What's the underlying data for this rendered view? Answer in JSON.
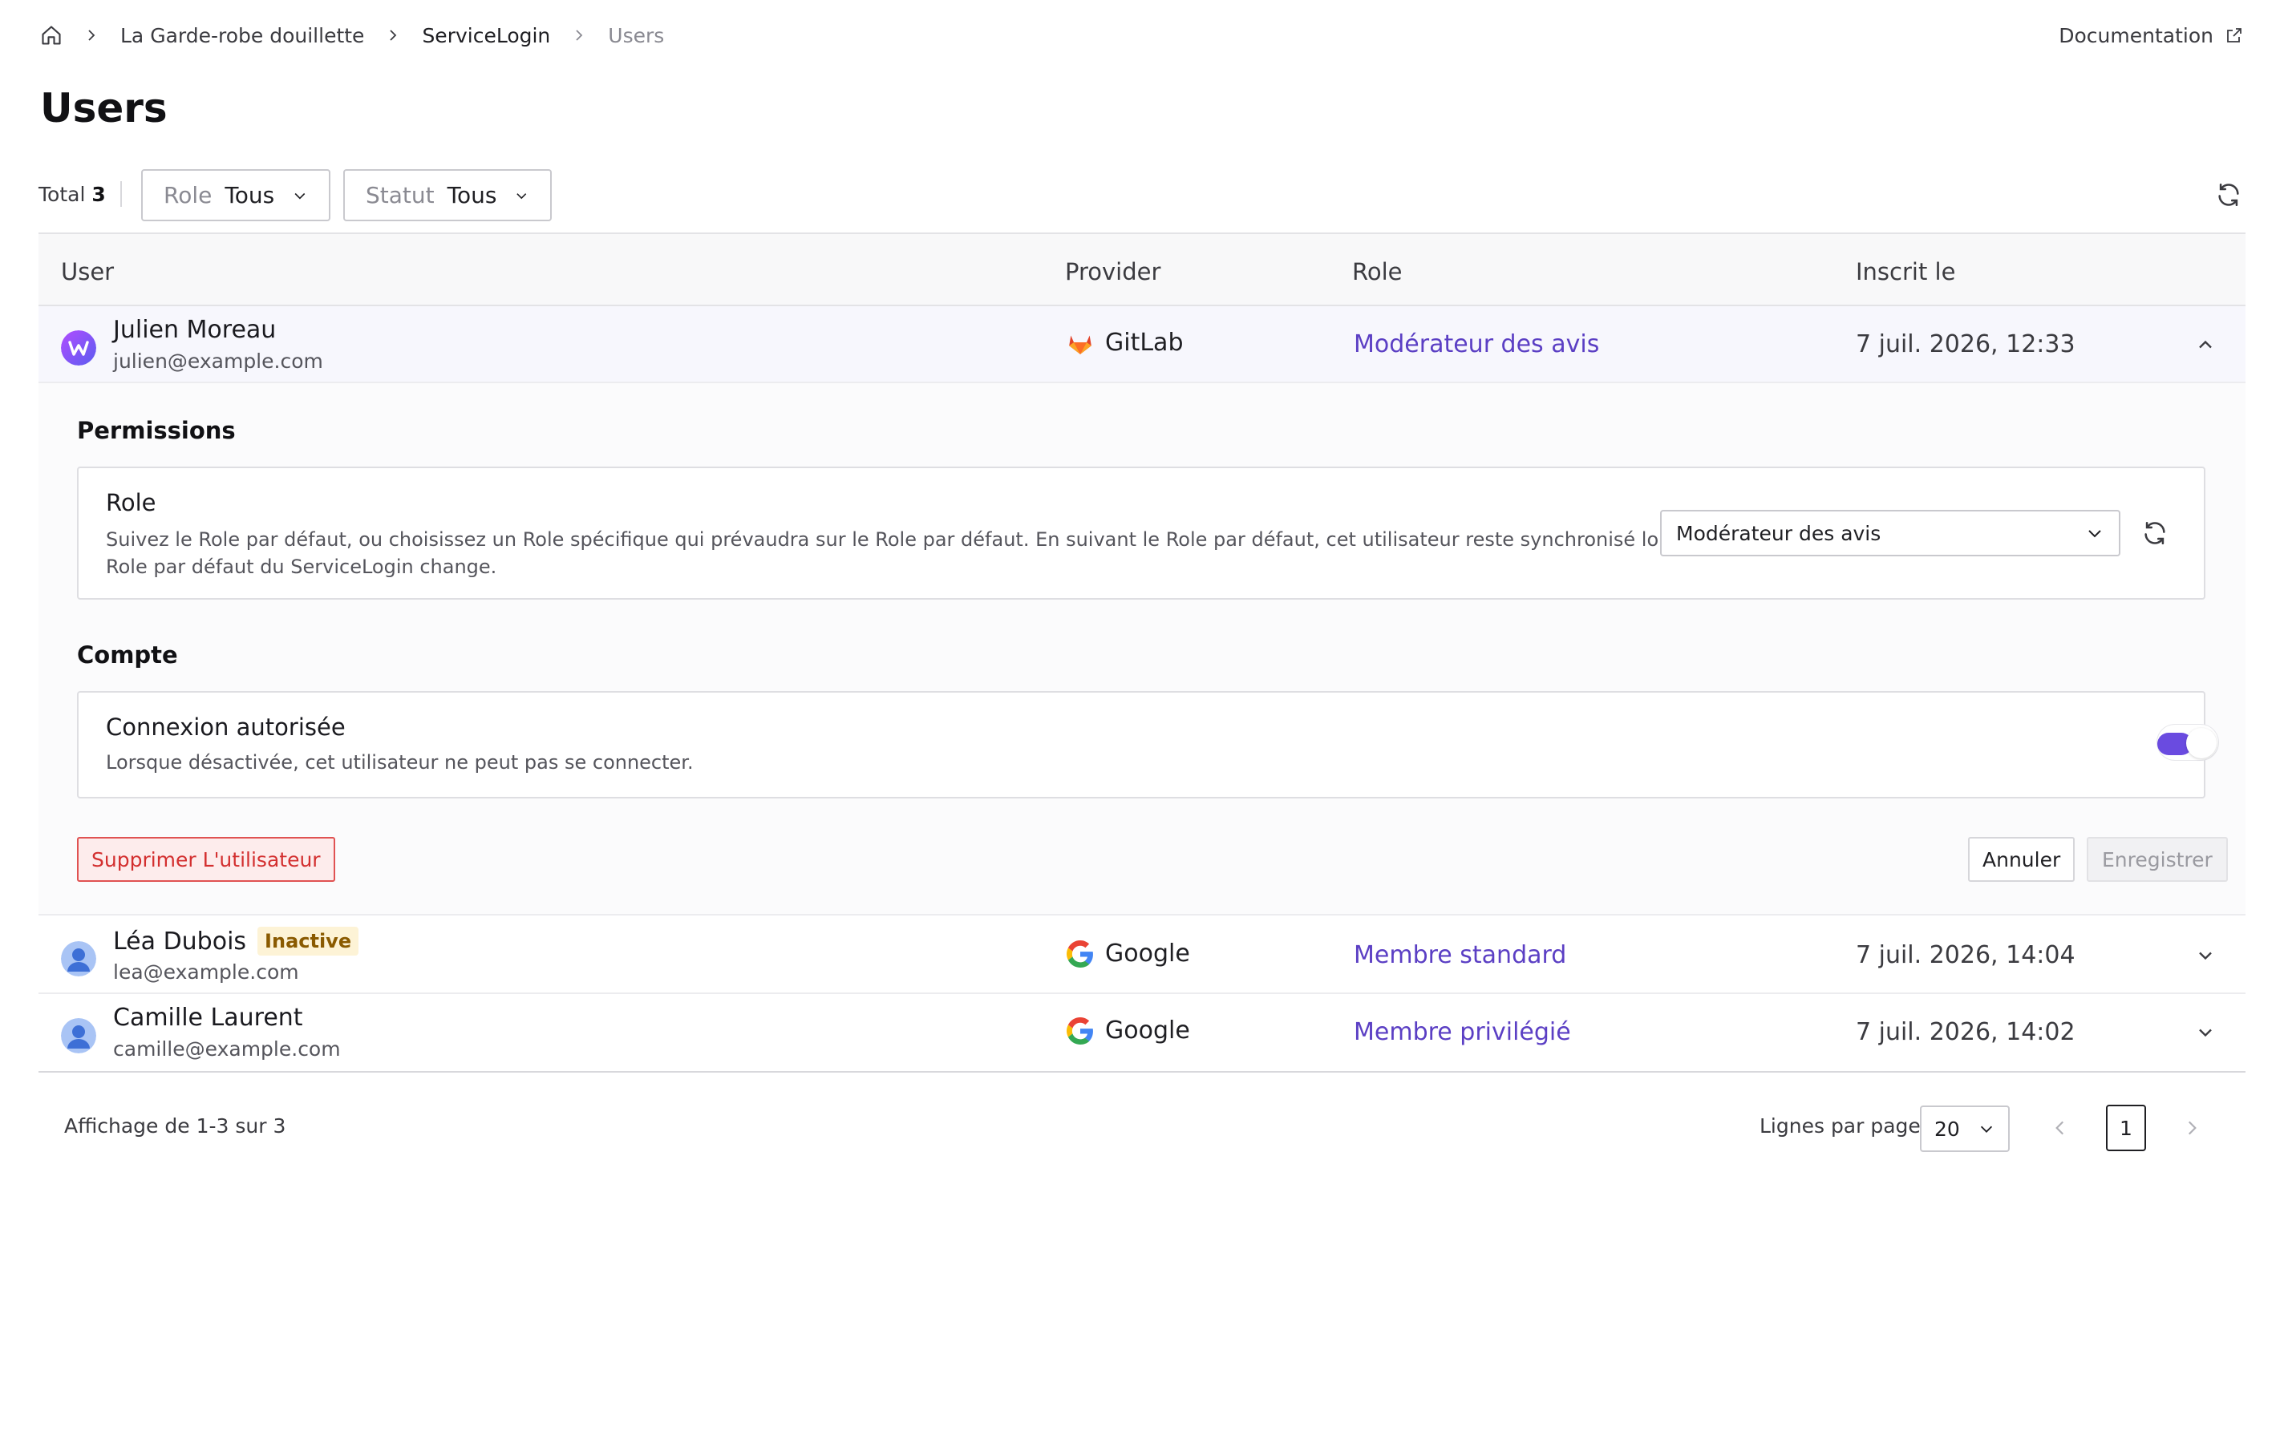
{
  "breadcrumb": {
    "items": [
      "La Garde-robe douillette",
      "ServiceLogin",
      "Users"
    ]
  },
  "header": {
    "title": "Users",
    "doc_link": "Documentation"
  },
  "filters": {
    "total_label": "Total",
    "total_count": "3",
    "role": {
      "label": "Role",
      "value": "Tous"
    },
    "status": {
      "label": "Statut",
      "value": "Tous"
    }
  },
  "table": {
    "columns": [
      "User",
      "Provider",
      "Role",
      "Inscrit le"
    ],
    "rows": [
      {
        "name": "Julien Moreau",
        "email": "julien@example.com",
        "provider": "GitLab",
        "role": "Modérateur des avis",
        "date": "7 juil. 2026, 12:33",
        "badge": ""
      },
      {
        "name": "Léa Dubois",
        "email": "lea@example.com",
        "provider": "Google",
        "role": "Membre standard",
        "date": "7 juil. 2026, 14:04",
        "badge": "Inactive"
      },
      {
        "name": "Camille Laurent",
        "email": "camille@example.com",
        "provider": "Google",
        "role": "Membre privilégié",
        "date": "7 juil. 2026, 14:02",
        "badge": ""
      }
    ]
  },
  "expanded": {
    "permissions_title": "Permissions",
    "role_card": {
      "title": "Role",
      "desc_line1": "Suivez le Role par défaut, ou choisissez un Role spécifique qui prévaudra sur le Role par défaut. En suivant le Role par défaut, cet utilisateur reste synchronisé lorsque le",
      "desc_line2": "Role par défaut du ServiceLogin change.",
      "selected": "Modérateur des avis"
    },
    "account_title": "Compte",
    "login_card": {
      "title": "Connexion autorisée",
      "desc": "Lorsque désactivée, cet utilisateur ne peut pas se connecter.",
      "enabled": true
    },
    "delete_label": "Supprimer L'utilisateur",
    "cancel_label": "Annuler",
    "save_label": "Enregistrer"
  },
  "footer": {
    "showing": "Affichage de 1-3 sur 3",
    "rows_per_page_label": "Lignes par page",
    "rows_per_page": "20",
    "page": "1"
  },
  "colors": {
    "accent": "#5b3fc4",
    "toggle_on": "#6a4be0",
    "danger": "#d32f2f",
    "badge_bg": "#fdf3d6"
  }
}
